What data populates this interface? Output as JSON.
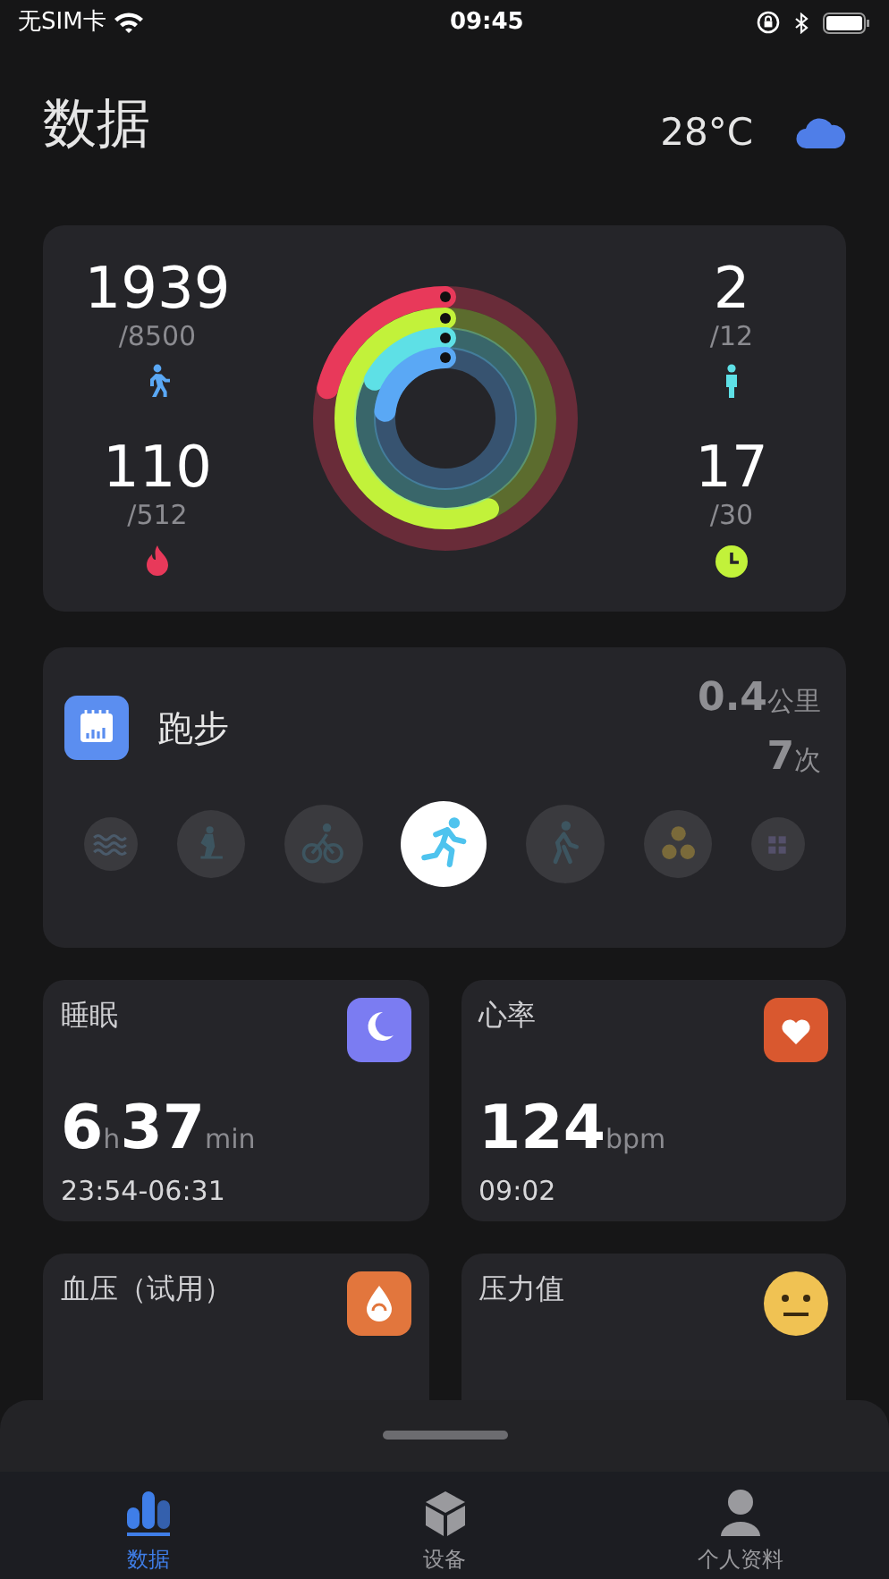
{
  "status_bar": {
    "carrier": "无SIM卡",
    "time": "09:45"
  },
  "header": {
    "title": "数据",
    "temperature": "28°C"
  },
  "activity": {
    "metrics": [
      {
        "kind": "steps",
        "value": "1939",
        "goal": "/8500",
        "color": "#5aa8f5",
        "level": 0.23
      },
      {
        "kind": "calories",
        "value": "110",
        "goal": "/512",
        "color": "#e8395a",
        "level": 0.21
      },
      {
        "kind": "stand",
        "value": "2",
        "goal": "/12",
        "color": "#5ee0e6",
        "level": 0.17
      },
      {
        "kind": "minutes",
        "value": "17",
        "goal": "/30",
        "color": "#c2f23a",
        "level": 0.57
      }
    ]
  },
  "sport": {
    "title": "跑步",
    "distance": "0.4",
    "distance_unit": "公里",
    "count": "7",
    "count_unit": "次",
    "modes": [
      {
        "kind": "swim",
        "selected": false
      },
      {
        "kind": "elliptical",
        "selected": false
      },
      {
        "kind": "bike",
        "selected": false
      },
      {
        "kind": "run",
        "selected": true
      },
      {
        "kind": "walk",
        "selected": false
      },
      {
        "kind": "ball",
        "selected": false
      },
      {
        "kind": "more",
        "selected": false
      }
    ]
  },
  "tiles": [
    {
      "kind": "sleep",
      "title": "睡眠",
      "value": [
        {
          "text": "6",
          "unit": false
        },
        {
          "text": "h",
          "unit": true
        },
        {
          "text": "37",
          "unit": false
        },
        {
          "text": "min",
          "unit": true
        }
      ],
      "detail": "23:54-06:31",
      "color": "#7b7cf2"
    },
    {
      "kind": "heart",
      "title": "心率",
      "value": [
        {
          "text": "124",
          "unit": false
        },
        {
          "text": "bpm",
          "unit": true
        }
      ],
      "detail": "09:02",
      "color": "#d9582f"
    },
    {
      "kind": "pressure",
      "title": "血压（试用）",
      "color": "#e2763d"
    },
    {
      "kind": "stress",
      "title": "压力值",
      "color": "#f0c253"
    }
  ],
  "tab_bar": [
    {
      "kind": "data",
      "label": "数据",
      "selected": true
    },
    {
      "kind": "device",
      "label": "设备",
      "selected": false
    },
    {
      "kind": "profile",
      "label": "个人资料",
      "selected": false
    }
  ]
}
